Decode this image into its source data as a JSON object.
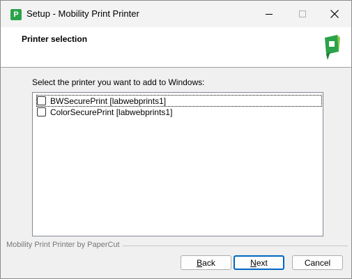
{
  "window": {
    "title": "Setup - Mobility Print Printer",
    "app_icon_letter": "P"
  },
  "header": {
    "title": "Printer selection"
  },
  "main": {
    "prompt": "Select the printer you want to add to Windows:",
    "printers": [
      {
        "label": "BWSecurePrint [labwebprints1]",
        "checked": false
      },
      {
        "label": "ColorSecurePrint [labwebprints1]",
        "checked": false
      }
    ]
  },
  "footer": {
    "brand_label": "Mobility Print Printer by PaperCut"
  },
  "buttons": {
    "back_first": "B",
    "back_rest": "ack",
    "next_first": "N",
    "next_rest": "ext",
    "cancel": "Cancel"
  },
  "colors": {
    "brand_green": "#2aa24a",
    "default_button_border": "#0067c0"
  }
}
